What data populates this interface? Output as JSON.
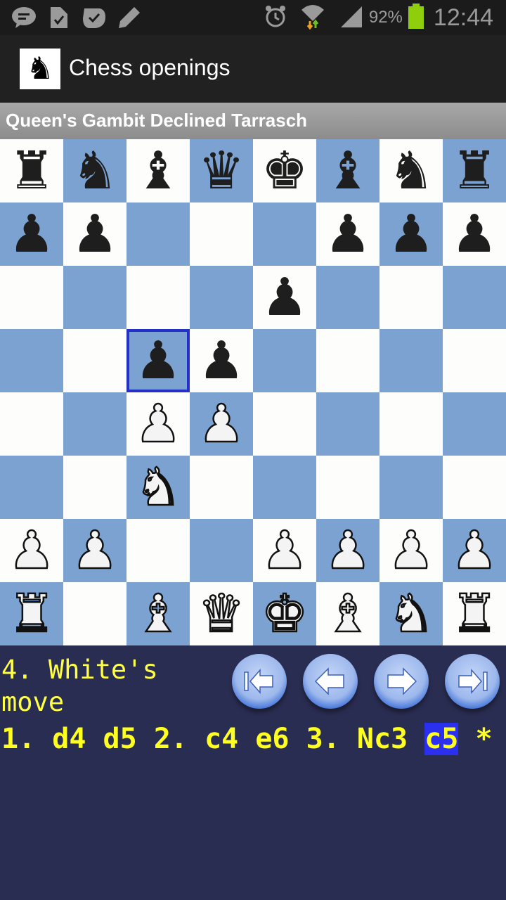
{
  "status_bar": {
    "notification_icons": [
      "message-icon",
      "task-check-icon",
      "check-badge-icon",
      "pencil-icon"
    ],
    "system_icons": [
      "alarm-icon",
      "wifi-icon",
      "signal-icon",
      "battery-icon"
    ],
    "battery_percent": "92%",
    "time": "12:44",
    "battery_color": "#8fce0a"
  },
  "app_bar": {
    "title": "Chess openings",
    "logo_icon": "knight-icon"
  },
  "opening_name": "Queen's Gambit Declined Tarrasch",
  "board": {
    "light_color": "#fdfdfb",
    "dark_color": "#7ca2d2",
    "highlight_color": "#2431c9",
    "selected_square": "c5",
    "ranks": [
      [
        "r",
        "n",
        "b",
        "q",
        "k",
        "b",
        "n",
        "r"
      ],
      [
        "p",
        "p",
        "",
        "",
        "",
        "p",
        "p",
        "p"
      ],
      [
        "",
        "",
        "",
        "",
        "p",
        "",
        "",
        ""
      ],
      [
        "",
        "",
        "p",
        "p",
        "",
        "",
        "",
        ""
      ],
      [
        "",
        "",
        "P",
        "P",
        "",
        "",
        "",
        ""
      ],
      [
        "",
        "",
        "N",
        "",
        "",
        "",
        "",
        ""
      ],
      [
        "P",
        "P",
        "",
        "",
        "P",
        "P",
        "P",
        "P"
      ],
      [
        "R",
        "",
        "B",
        "Q",
        "K",
        "B",
        "N",
        "R"
      ]
    ]
  },
  "game_panel": {
    "turn_status": "4. White's move",
    "nav_buttons": [
      {
        "name": "first-move-button",
        "icon": "skip-back-icon"
      },
      {
        "name": "previous-move-button",
        "icon": "arrow-left-icon"
      },
      {
        "name": "next-move-button",
        "icon": "arrow-right-icon"
      },
      {
        "name": "last-move-button",
        "icon": "skip-forward-icon"
      }
    ],
    "moves": [
      {
        "text": "1.",
        "type": "num"
      },
      {
        "text": "d4",
        "type": "move"
      },
      {
        "text": "d5",
        "type": "move"
      },
      {
        "text": "2.",
        "type": "num"
      },
      {
        "text": "c4",
        "type": "move"
      },
      {
        "text": "e6",
        "type": "move"
      },
      {
        "text": "3.",
        "type": "num"
      },
      {
        "text": "Nc3",
        "type": "move"
      },
      {
        "text": "c5",
        "type": "move",
        "current": true
      },
      {
        "text": "*",
        "type": "result"
      }
    ],
    "text_color": "#ffff22",
    "current_move_bg": "#2a2ff0"
  }
}
